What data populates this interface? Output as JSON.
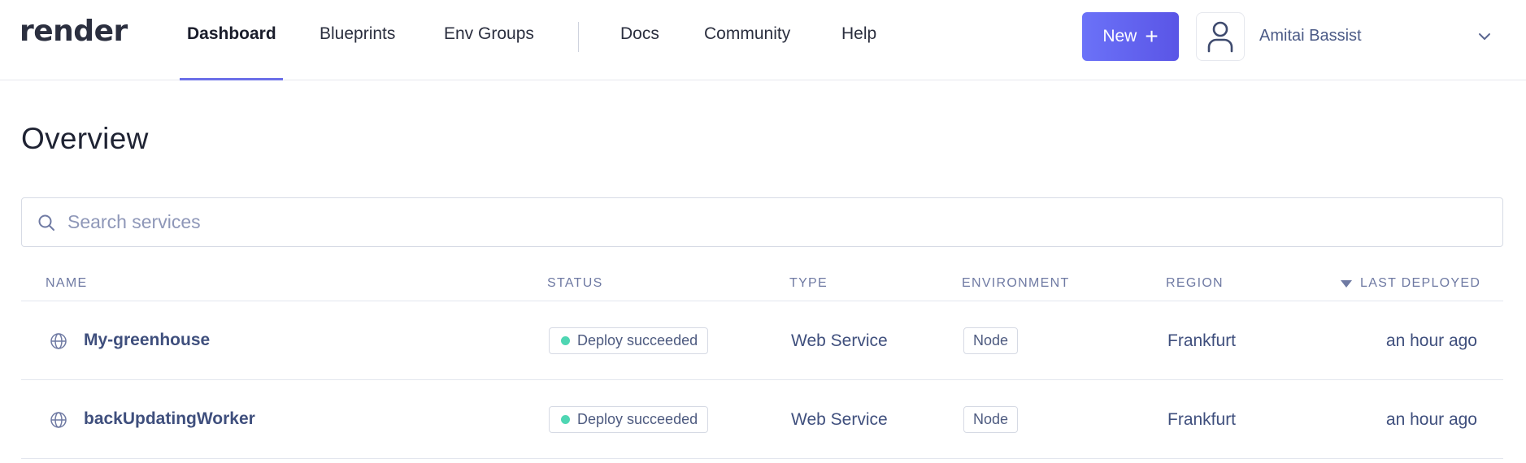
{
  "app": {
    "logo": "render"
  },
  "nav": {
    "items": [
      {
        "label": "Dashboard",
        "active": true
      },
      {
        "label": "Blueprints",
        "active": false
      },
      {
        "label": "Env Groups",
        "active": false
      },
      {
        "label": "Docs",
        "active": false
      },
      {
        "label": "Community",
        "active": false
      },
      {
        "label": "Help",
        "active": false
      }
    ]
  },
  "header": {
    "new_button_label": "New",
    "new_button_icon": "plus-icon",
    "user_name": "Amitai Bassist",
    "user_avatar_icon": "user-icon",
    "user_menu_icon": "chevron-down-icon"
  },
  "page": {
    "title": "Overview"
  },
  "search": {
    "placeholder": "Search services",
    "value": "",
    "icon": "search-icon"
  },
  "table": {
    "columns": [
      {
        "label": "NAME"
      },
      {
        "label": "STATUS"
      },
      {
        "label": "TYPE"
      },
      {
        "label": "ENVIRONMENT"
      },
      {
        "label": "REGION"
      },
      {
        "label": "LAST DEPLOYED",
        "sorted": "descending"
      }
    ],
    "rows": [
      {
        "icon": "globe-icon",
        "name": "My-greenhouse",
        "status": "Deploy succeeded",
        "type": "Web Service",
        "environment": "Node",
        "region": "Frankfurt",
        "last_deployed": "an hour ago"
      },
      {
        "icon": "globe-icon",
        "name": "backUpdatingWorker",
        "status": "Deploy succeeded",
        "type": "Web Service",
        "environment": "Node",
        "region": "Frankfurt",
        "last_deployed": "an hour ago"
      }
    ]
  },
  "colors": {
    "accent": "#6b6fe8",
    "new_button_start": "#6b72f8",
    "new_button_end": "#5a55e6",
    "status_success": "#4fd6b3",
    "link_text": "#3f4f7d"
  }
}
